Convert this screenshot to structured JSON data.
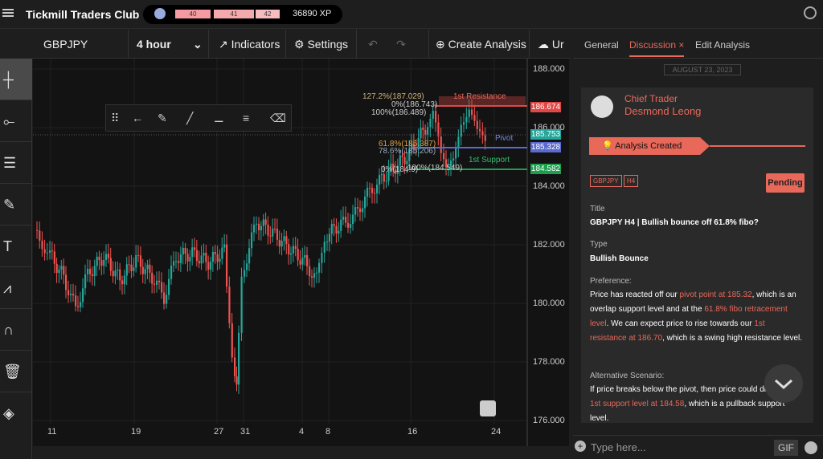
{
  "app": {
    "title": "Tickmill Traders Club",
    "xp_levels": [
      "40",
      "41",
      "42"
    ],
    "xp": "36890 XP"
  },
  "toolbar": {
    "symbol": "GBPJPY",
    "interval": "4 hour",
    "indicators": "Indicators",
    "settings": "Settings",
    "create": "Create Analysis",
    "more": "Ur"
  },
  "chart": {
    "y_ticks": [
      "188.000",
      "186.000",
      "184.000",
      "182.000",
      "180.000",
      "178.000",
      "176.000"
    ],
    "x_ticks": [
      "11",
      "19",
      "27",
      "31",
      "4",
      "8",
      "16",
      "24"
    ],
    "price_tags": [
      {
        "label": "186.674",
        "color": "#e04848"
      },
      {
        "label": "185.753",
        "color": "#26a69a"
      },
      {
        "label": "185.328",
        "color": "#5a6ad0"
      },
      {
        "label": "184.582",
        "color": "#1f9e50"
      }
    ],
    "annotations": {
      "r1": "1st Resistance",
      "pivot": "Pivot",
      "s1": "1st Support",
      "f1272": "127.2%(187.029)",
      "f0": "0%(186.743)",
      "f100": "100%(186.489)",
      "f618": "61.8%(185.387)",
      "f786": "78.6%(185.206)",
      "fsum": "0%(184.9)",
      "f100b": "100%(184.549)"
    }
  },
  "panel": {
    "tabs": [
      "General",
      "Discussion",
      "Edit Analysis"
    ],
    "date": "AUGUST 23, 2023",
    "author": {
      "role": "Chief Trader",
      "name": "Desmond Leong"
    },
    "status": "Analysis Created",
    "chips": [
      "GBPJPY",
      "H4"
    ],
    "pending": "Pending",
    "title_label": "Title",
    "title": "GBPJPY H4 | Bullish bounce off 61.8% fibo?",
    "type_label": "Type",
    "type": "Bullish Bounce",
    "pref_label": "Preference:",
    "pref": [
      "Price has reacted off our ",
      "pivot point at 185.32",
      ", which is an overlap support level and at the ",
      "61.8% fibo retracement level",
      ". We can expect price to rise towards our ",
      "1st resistance at 186.70",
      ", which is a swing high resistance level."
    ],
    "alt_label": "Alternative Scenario:",
    "alt": [
      "If price breaks below the pivot, then price could drop to the ",
      "1st support level at 184.58",
      ", which is a pullback support level."
    ],
    "compose": "Type here...",
    "gif": "GIF"
  }
}
